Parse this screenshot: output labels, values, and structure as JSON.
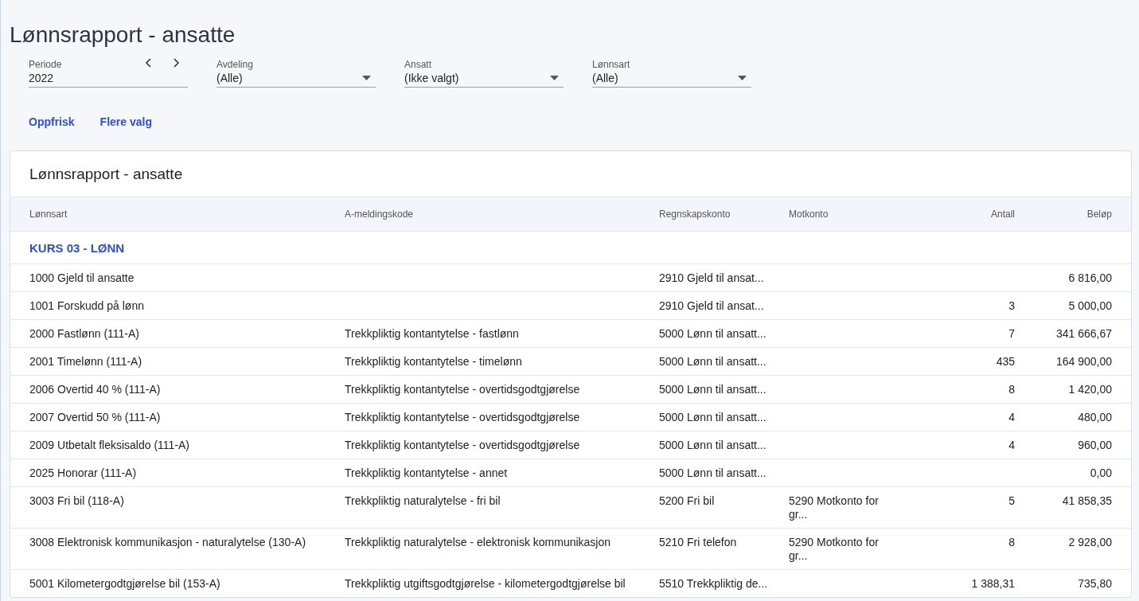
{
  "page_title": "Lønnsrapport - ansatte",
  "filters": [
    {
      "kind": "period",
      "label": "Periode",
      "value": "2022"
    },
    {
      "kind": "dropdown",
      "label": "Avdeling",
      "value": "(Alle)"
    },
    {
      "kind": "dropdown",
      "label": "Ansatt",
      "value": "(Ikke valgt)"
    },
    {
      "kind": "dropdown",
      "label": "Lønnsart",
      "value": "(Alle)"
    }
  ],
  "actions": [
    "Oppfrisk",
    "Flere valg"
  ],
  "report": {
    "title": "Lønnsrapport - ansatte",
    "table": {
      "columns": [
        "Lønnsart",
        "A-meldingskode",
        "Regnskapskonto",
        "Motkonto",
        "Antall",
        "Beløp"
      ],
      "group": "KURS 03 - LØNN",
      "rows": [
        [
          "1000 Gjeld til ansatte",
          "",
          "2910 Gjeld til ansat...",
          "",
          "",
          "6 816,00"
        ],
        [
          "1001 Forskudd på lønn",
          "",
          "2910 Gjeld til ansat...",
          "",
          "3",
          "5 000,00"
        ],
        [
          "2000 Fastlønn (111-A)",
          "Trekkpliktig kontantytelse - fastlønn",
          "5000 Lønn til ansatt...",
          "",
          "7",
          "341 666,67"
        ],
        [
          "2001 Timelønn (111-A)",
          "Trekkpliktig kontantytelse - timelønn",
          "5000 Lønn til ansatt...",
          "",
          "435",
          "164 900,00"
        ],
        [
          "2006 Overtid 40 % (111-A)",
          "Trekkpliktig kontantytelse - overtidsgodtgjørelse",
          "5000 Lønn til ansatt...",
          "",
          "8",
          "1 420,00"
        ],
        [
          "2007 Overtid 50 % (111-A)",
          "Trekkpliktig kontantytelse - overtidsgodtgjørelse",
          "5000 Lønn til ansatt...",
          "",
          "4",
          "480,00"
        ],
        [
          "2009 Utbetalt fleksisaldo (111-A)",
          "Trekkpliktig kontantytelse - overtidsgodtgjørelse",
          "5000 Lønn til ansatt...",
          "",
          "4",
          "960,00"
        ],
        [
          "2025 Honorar (111-A)",
          "Trekkpliktig kontantytelse - annet",
          "5000 Lønn til ansatt...",
          "",
          "",
          "0,00"
        ],
        [
          "3003 Fri bil (118-A)",
          "Trekkpliktig naturalytelse - fri bil",
          "5200 Fri bil",
          "5290 Motkonto for gr...",
          "5",
          "41 858,35"
        ],
        [
          "3008 Elektronisk kommunikasjon - naturalytelse (130-A)",
          "Trekkpliktig naturalytelse - elektronisk kommunikasjon",
          "5210 Fri telefon",
          "5290 Motkonto for gr...",
          "8",
          "2 928,00"
        ],
        [
          "5001 Kilometergodtgjørelse bil (153-A)",
          "Trekkpliktig utgiftsgodtgjørelse - kilometergodtgjørelse bil",
          "5510 Trekkpliktig de...",
          "",
          "1 388,31",
          "735,80"
        ]
      ]
    }
  }
}
